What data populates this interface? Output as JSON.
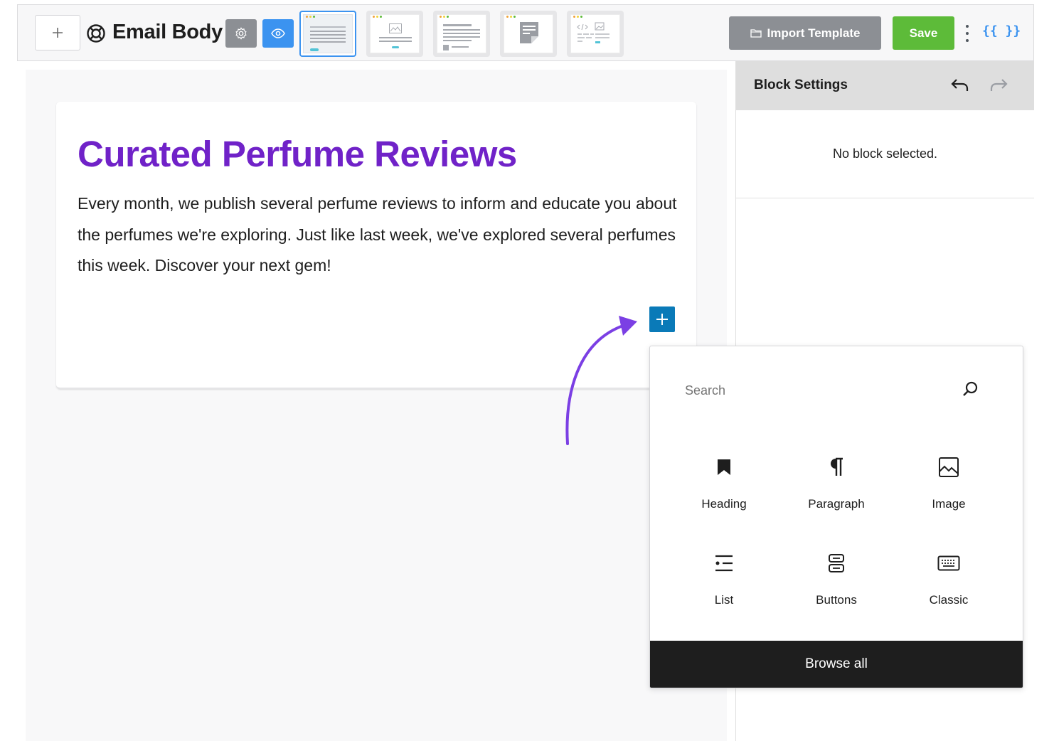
{
  "toolbar": {
    "title": "Email Body",
    "add_icon": "plus-icon",
    "editor_icon": "lifebuoy-icon",
    "settings_icon": "gear-icon",
    "preview_icon": "eye-icon",
    "templates": [
      "template-text",
      "template-image",
      "template-article",
      "template-note",
      "template-html-image"
    ],
    "import_label": "Import Template",
    "import_icon": "folder-icon",
    "save_label": "Save",
    "more_icon": "kebab-icon",
    "merge_tags_label": "{{ }}",
    "colors": {
      "save": "#5dbb39",
      "import": "#8c8f94",
      "preview": "#3b93f0",
      "accent": "#3b93f0"
    }
  },
  "canvas": {
    "heading": "Curated Perfume Reviews",
    "paragraph": "Every month, we publish several perfume reviews to inform and educate you about the perfumes we're exploring. Just like last week, we've explored several perfumes this week. Discover your next gem!",
    "insert_icon": "plus-icon",
    "colors": {
      "heading": "#7022c8",
      "insert_button": "#0a7ab8",
      "arrow": "#7b3fe4"
    }
  },
  "sidebar": {
    "title": "Block Settings",
    "undo_icon": "undo-icon",
    "redo_icon": "redo-icon",
    "empty_message": "No block selected."
  },
  "inserter": {
    "search_placeholder": "Search",
    "search_icon": "search-icon",
    "blocks": [
      {
        "label": "Heading",
        "icon": "bookmark-icon"
      },
      {
        "label": "Paragraph",
        "icon": "pilcrow-icon"
      },
      {
        "label": "Image",
        "icon": "image-icon"
      },
      {
        "label": "List",
        "icon": "list-icon"
      },
      {
        "label": "Buttons",
        "icon": "buttons-icon"
      },
      {
        "label": "Classic",
        "icon": "keyboard-icon"
      }
    ],
    "browse_all_label": "Browse all"
  }
}
